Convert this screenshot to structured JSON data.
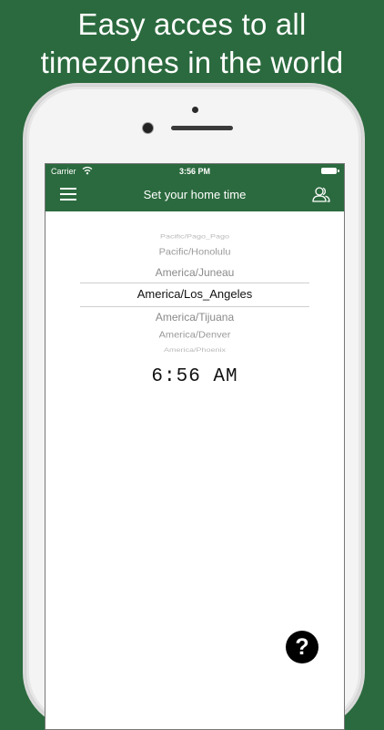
{
  "headline": {
    "line1": "Easy acces to all",
    "line2": "timezones in the world"
  },
  "status_bar": {
    "carrier": "Carrier",
    "time": "3:56 PM"
  },
  "nav": {
    "title": "Set your home time",
    "menu_icon": "hamburger-menu-icon",
    "users_icon": "users-icon"
  },
  "picker": {
    "items": [
      "Pacific/Pago_Pago",
      "Pacific/Honolulu",
      "America/Juneau",
      "America/Los_Angeles",
      "America/Tijuana",
      "America/Denver",
      "America/Phoenix"
    ],
    "selected": "America/Los_Angeles"
  },
  "time_display": "6:56 AM",
  "help_button": {
    "label": "?"
  },
  "colors": {
    "brand_green": "#2b6a3e",
    "screen_bg": "#ffffff"
  }
}
